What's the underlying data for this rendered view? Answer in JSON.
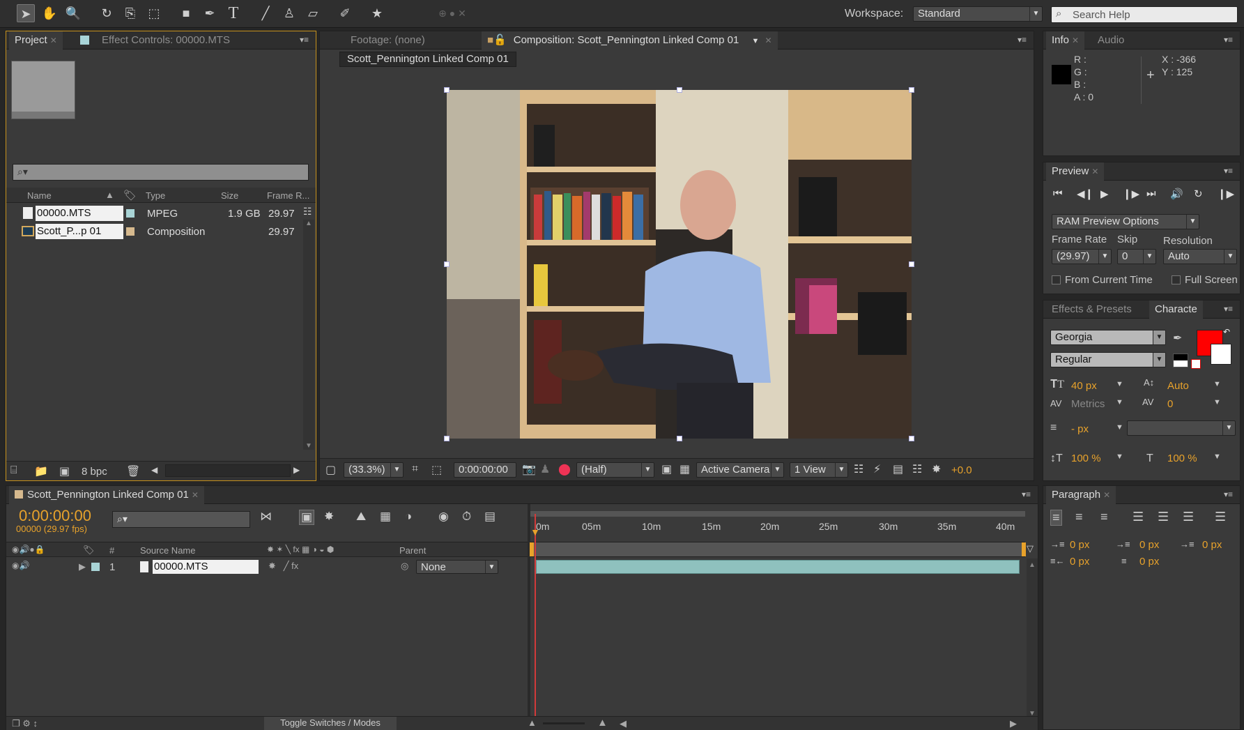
{
  "toolbar": {
    "workspace_label": "Workspace:",
    "workspace_value": "Standard",
    "search_placeholder": "Search Help"
  },
  "project_panel": {
    "tab_project": "Project",
    "tab_effect_controls": "Effect Controls: 00000.MTS",
    "columns": [
      "Name",
      "Type",
      "Size",
      "Frame R..."
    ],
    "rows": [
      {
        "name": "00000.MTS",
        "type": "MPEG",
        "size": "1.9 GB",
        "frame_rate": "29.97"
      },
      {
        "name": "Scott_P...p 01",
        "type": "Composition",
        "size": "",
        "frame_rate": "29.97"
      }
    ],
    "bpc": "8 bpc"
  },
  "comp_panel": {
    "tab_footage": "Footage: (none)",
    "tab_composition": "Composition: Scott_Pennington Linked Comp 01",
    "comp_name": "Scott_Pennington Linked Comp 01",
    "zoom": "(33.3%)",
    "timecode": "0:00:00:00",
    "resolution": "(Half)",
    "camera": "Active Camera",
    "views": "1 View",
    "exposure": "+0.0"
  },
  "info_panel": {
    "tab_info": "Info",
    "tab_audio": "Audio",
    "r": "R :",
    "g": "G :",
    "b": "B :",
    "a": "A : 0",
    "x": "X : -366",
    "y": "Y : 125"
  },
  "preview_panel": {
    "tab": "Preview",
    "ram_options": "RAM Preview Options",
    "frame_rate_label": "Frame Rate",
    "skip_label": "Skip",
    "resolution_label": "Resolution",
    "frame_rate_value": "(29.97)",
    "skip_value": "0",
    "resolution_value": "Auto",
    "from_current": "From Current Time",
    "full_screen": "Full Screen"
  },
  "character_panel": {
    "tab_effects": "Effects & Presets",
    "tab_character": "Characte",
    "font": "Georgia",
    "style": "Regular",
    "font_size": "40 px",
    "leading": "Auto",
    "kerning": "Metrics",
    "tracking": "0",
    "stroke_width": "- px",
    "vscale": "100 %",
    "hscale": "100 %",
    "fill_color": "#ff0000"
  },
  "timeline_panel": {
    "tab": "Scott_Pennington Linked Comp 01",
    "timecode": "0:00:00:00",
    "frames": "00000 (29.97 fps)",
    "col_source": "Source Name",
    "col_parent": "Parent",
    "layer_num": "1",
    "layer_name": "00000.MTS",
    "parent_value": "None",
    "ruler": [
      "0m",
      "05m",
      "10m",
      "15m",
      "20m",
      "25m",
      "30m",
      "35m",
      "40m"
    ],
    "toggle_label": "Toggle Switches / Modes"
  },
  "paragraph_panel": {
    "tab": "Paragraph",
    "indent_left": "0 px",
    "indent_first": "0 px",
    "indent_right": "0 px",
    "space_before": "0 px",
    "space_after": "0 px"
  }
}
